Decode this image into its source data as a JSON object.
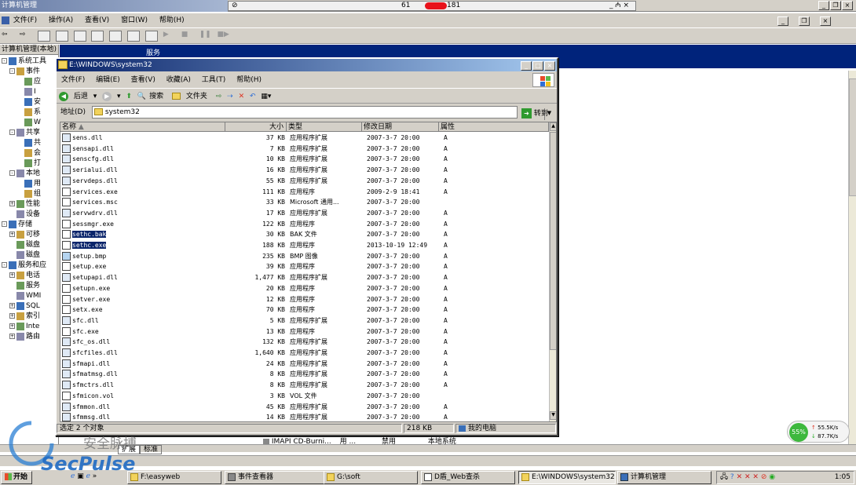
{
  "outer": {
    "title": "计算机管理",
    "remote_title_left": "61",
    "remote_title_right": "181",
    "remote_ctl": "_ ₼ ×"
  },
  "mmc_menu": [
    "文件(F)",
    "操作(A)",
    "查看(V)",
    "窗口(W)",
    "帮助(H)"
  ],
  "mmc": {
    "tree_header": "计算机管理(本地)",
    "right_title": "服务"
  },
  "tree": [
    {
      "label": "系统工具",
      "indent": 1,
      "toggle": "-"
    },
    {
      "label": "事件",
      "indent": 2,
      "toggle": "-"
    },
    {
      "label": "应",
      "indent": 3,
      "toggle": ""
    },
    {
      "label": "I",
      "indent": 3,
      "toggle": ""
    },
    {
      "label": "安",
      "indent": 3,
      "toggle": ""
    },
    {
      "label": "系",
      "indent": 3,
      "toggle": ""
    },
    {
      "label": "W",
      "indent": 3,
      "toggle": ""
    },
    {
      "label": "共享",
      "indent": 2,
      "toggle": "-"
    },
    {
      "label": "共",
      "indent": 3,
      "toggle": ""
    },
    {
      "label": "会",
      "indent": 3,
      "toggle": ""
    },
    {
      "label": "打",
      "indent": 3,
      "toggle": ""
    },
    {
      "label": "本地",
      "indent": 2,
      "toggle": "-"
    },
    {
      "label": "用",
      "indent": 3,
      "toggle": ""
    },
    {
      "label": "组",
      "indent": 3,
      "toggle": ""
    },
    {
      "label": "性能",
      "indent": 2,
      "toggle": "+"
    },
    {
      "label": "设备",
      "indent": 2,
      "toggle": ""
    },
    {
      "label": "存储",
      "indent": 1,
      "toggle": "-"
    },
    {
      "label": "可移",
      "indent": 2,
      "toggle": "+"
    },
    {
      "label": "磁盘",
      "indent": 2,
      "toggle": ""
    },
    {
      "label": "磁盘",
      "indent": 2,
      "toggle": ""
    },
    {
      "label": "服务和应",
      "indent": 1,
      "toggle": "-"
    },
    {
      "label": "电话",
      "indent": 2,
      "toggle": "+"
    },
    {
      "label": "服务",
      "indent": 2,
      "toggle": ""
    },
    {
      "label": "WMI",
      "indent": 2,
      "toggle": ""
    },
    {
      "label": "SQL",
      "indent": 2,
      "toggle": "+"
    },
    {
      "label": "索引",
      "indent": 2,
      "toggle": "+"
    },
    {
      "label": "Inte",
      "indent": 2,
      "toggle": "+"
    },
    {
      "label": "路由",
      "indent": 2,
      "toggle": "+"
    }
  ],
  "explorer": {
    "title": "E:\\WINDOWS\\system32",
    "menu": [
      "文件(F)",
      "编辑(E)",
      "查看(V)",
      "收藏(A)",
      "工具(T)",
      "帮助(H)"
    ],
    "toolbar": {
      "back": "后退",
      "search": "搜索",
      "folders": "文件夹"
    },
    "address_label": "地址(D)",
    "address_value": "system32",
    "go_label": "转到",
    "columns": [
      "名称",
      "大小",
      "类型",
      "修改日期",
      "属性"
    ],
    "files": [
      {
        "name": "sens.dll",
        "size": "37 KB",
        "type": "应用程序扩展",
        "date": "2007-3-7 20:00",
        "attr": "A"
      },
      {
        "name": "sensapi.dll",
        "size": "7 KB",
        "type": "应用程序扩展",
        "date": "2007-3-7 20:00",
        "attr": "A"
      },
      {
        "name": "senscfg.dll",
        "size": "10 KB",
        "type": "应用程序扩展",
        "date": "2007-3-7 20:00",
        "attr": "A"
      },
      {
        "name": "serialui.dll",
        "size": "16 KB",
        "type": "应用程序扩展",
        "date": "2007-3-7 20:00",
        "attr": "A"
      },
      {
        "name": "servdeps.dll",
        "size": "55 KB",
        "type": "应用程序扩展",
        "date": "2007-3-7 20:00",
        "attr": "A"
      },
      {
        "name": "services.exe",
        "size": "111 KB",
        "type": "应用程序",
        "date": "2009-2-9 18:41",
        "attr": "A"
      },
      {
        "name": "services.msc",
        "size": "33 KB",
        "type": "Microsoft 通用...",
        "date": "2007-3-7 20:00",
        "attr": ""
      },
      {
        "name": "servwdrv.dll",
        "size": "17 KB",
        "type": "应用程序扩展",
        "date": "2007-3-7 20:00",
        "attr": "A"
      },
      {
        "name": "sessmgr.exe",
        "size": "122 KB",
        "type": "应用程序",
        "date": "2007-3-7 20:00",
        "attr": "A"
      },
      {
        "name": "sethc.bak",
        "size": "30 KB",
        "type": "BAK 文件",
        "date": "2007-3-7 20:00",
        "attr": "A",
        "selected": true
      },
      {
        "name": "sethc.exe",
        "size": "188 KB",
        "type": "应用程序",
        "date": "2013-10-19 12:49",
        "attr": "A",
        "selected": true
      },
      {
        "name": "setup.bmp",
        "size": "235 KB",
        "type": "BMP 图像",
        "date": "2007-3-7 20:00",
        "attr": "A"
      },
      {
        "name": "setup.exe",
        "size": "39 KB",
        "type": "应用程序",
        "date": "2007-3-7 20:00",
        "attr": "A"
      },
      {
        "name": "setupapi.dll",
        "size": "1,477 KB",
        "type": "应用程序扩展",
        "date": "2007-3-7 20:00",
        "attr": "A"
      },
      {
        "name": "setupn.exe",
        "size": "20 KB",
        "type": "应用程序",
        "date": "2007-3-7 20:00",
        "attr": "A"
      },
      {
        "name": "setver.exe",
        "size": "12 KB",
        "type": "应用程序",
        "date": "2007-3-7 20:00",
        "attr": "A"
      },
      {
        "name": "setx.exe",
        "size": "70 KB",
        "type": "应用程序",
        "date": "2007-3-7 20:00",
        "attr": "A"
      },
      {
        "name": "sfc.dll",
        "size": "5 KB",
        "type": "应用程序扩展",
        "date": "2007-3-7 20:00",
        "attr": "A"
      },
      {
        "name": "sfc.exe",
        "size": "13 KB",
        "type": "应用程序",
        "date": "2007-3-7 20:00",
        "attr": "A"
      },
      {
        "name": "sfc_os.dll",
        "size": "132 KB",
        "type": "应用程序扩展",
        "date": "2007-3-7 20:00",
        "attr": "A"
      },
      {
        "name": "sfcfiles.dll",
        "size": "1,640 KB",
        "type": "应用程序扩展",
        "date": "2007-3-7 20:00",
        "attr": "A"
      },
      {
        "name": "sfmapi.dll",
        "size": "24 KB",
        "type": "应用程序扩展",
        "date": "2007-3-7 20:00",
        "attr": "A"
      },
      {
        "name": "sfmatmsg.dll",
        "size": "8 KB",
        "type": "应用程序扩展",
        "date": "2007-3-7 20:00",
        "attr": "A"
      },
      {
        "name": "sfmctrs.dll",
        "size": "8 KB",
        "type": "应用程序扩展",
        "date": "2007-3-7 20:00",
        "attr": "A"
      },
      {
        "name": "sfmicon.vol",
        "size": "3 KB",
        "type": "VOL 文件",
        "date": "2007-3-7 20:00",
        "attr": ""
      },
      {
        "name": "sfmmon.dll",
        "size": "45 KB",
        "type": "应用程序扩展",
        "date": "2007-3-7 20:00",
        "attr": "A"
      },
      {
        "name": "sfmmsg.dll",
        "size": "14 KB",
        "type": "应用程序扩展",
        "date": "2007-3-7 20:00",
        "attr": "A"
      }
    ],
    "status_left": "选定 2 个对象",
    "status_size": "218 KB",
    "status_right": "我的电脑"
  },
  "background_row": {
    "name": "IMAPI CD-Burni...",
    "desc": "用 ...",
    "status": "禁用",
    "account": "本地系统"
  },
  "tabs": [
    "扩展",
    "标准"
  ],
  "taskbar": {
    "start": "开始",
    "tasks": [
      "F:\\easyweb",
      "事件查看器",
      "G:\\soft",
      "D盾_Web查杀",
      "E:\\WINDOWS\\system32",
      "计算机管理"
    ],
    "clock": "1:05"
  },
  "network": {
    "percent": "55%",
    "up": "55.5K/s",
    "down": "87.7K/s"
  },
  "watermark": {
    "cn": "安全脉搏",
    "en": "SecPulse"
  }
}
